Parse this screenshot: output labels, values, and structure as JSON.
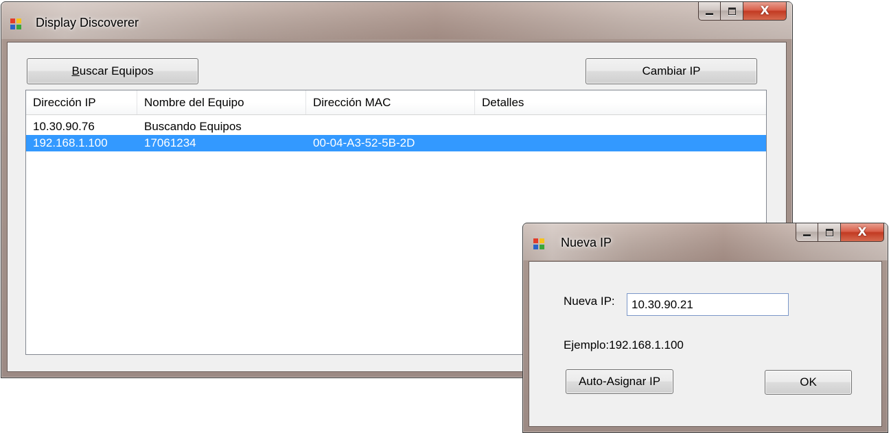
{
  "main_window": {
    "title": "Display Discoverer",
    "search_button": {
      "mnemonic": "B",
      "rest": "uscar Equipos"
    },
    "change_ip_button": "Cambiar IP",
    "list": {
      "columns": [
        "Dirección IP",
        "Nombre del Equipo",
        "Dirección MAC",
        "Detalles"
      ],
      "rows": [
        {
          "ip": "10.30.90.76",
          "name": "Buscando Equipos",
          "mac": "",
          "details": "",
          "selected": false
        },
        {
          "ip": "192.168.1.100",
          "name": "17061234",
          "mac": "00-04-A3-52-5B-2D",
          "details": "",
          "selected": true
        }
      ]
    }
  },
  "dialog": {
    "title": "Nueva IP",
    "new_ip_label": "Nueva IP:",
    "new_ip_value": "10.30.90.21",
    "example_label": "Ejemplo:192.168.1.100",
    "auto_assign_button": "Auto-Asignar IP",
    "ok_button": "OK"
  },
  "caption": {
    "close_glyph": "X"
  },
  "colors": {
    "selection": "#3399ff",
    "icon_red": "#e23b2a",
    "icon_yellow": "#f6c21c",
    "icon_blue": "#2a63c9",
    "icon_green": "#3aa63a"
  },
  "icons": [
    "app-icon",
    "minimize-icon",
    "maximize-icon",
    "close-icon"
  ]
}
